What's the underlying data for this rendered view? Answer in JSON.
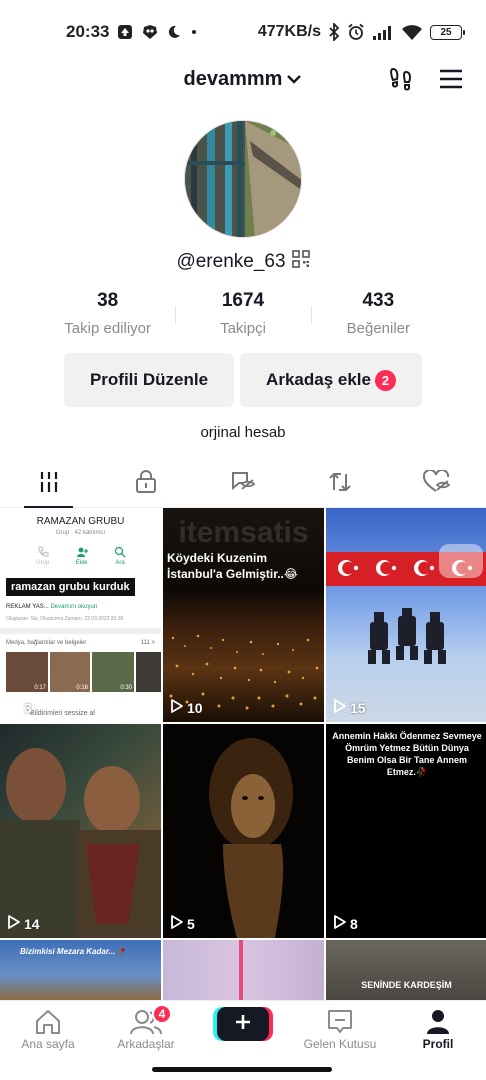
{
  "status_bar": {
    "time": "20:33",
    "net_speed": "477KB/s",
    "battery": "25"
  },
  "header": {
    "username": "devammm"
  },
  "profile": {
    "handle": "@erenke_63",
    "stats": [
      {
        "value": "38",
        "label": "Takip ediliyor"
      },
      {
        "value": "1674",
        "label": "Takipçi"
      },
      {
        "value": "433",
        "label": "Beğeniler"
      }
    ],
    "edit_button": "Profili Düzenle",
    "add_friend_button": "Arkadaş ekle",
    "add_friend_badge": "2",
    "bio": "orjinal hesab"
  },
  "videos": [
    {
      "views": "3",
      "group_title": "RAMAZAN GRUBU",
      "group_sub": "Grup · 42 katılımcı",
      "actions": [
        "Grup",
        "Ekle",
        "Ara"
      ],
      "sticker": "ramazan grubu kurduk",
      "desc": "REKLAM YAS...",
      "more": "Devamını okuyun",
      "created": "Oluşturan: Siz, Oluşturma Zamanı: 22.03.2023 20:36",
      "media_label": "Medya, bağlantılar ve belgeler",
      "media_count": "111 >",
      "thumb_times": [
        "0:17",
        "0:16",
        "0:30"
      ],
      "mute_label": "Bildirimleri sessize al"
    },
    {
      "views": "10",
      "caption": "Köydeki Kuzenim İstanbul'a Gelmiştir..😂",
      "watermark": "itemsatis"
    },
    {
      "views": "15"
    },
    {
      "views": "14"
    },
    {
      "views": "5"
    },
    {
      "views": "8",
      "caption": "Annemin Hakkı Ödenmez Sevmeye Ömrüm Yetmez Bütün Dünya Benim Olsa Bir Tane Annem Etmez.🥀"
    },
    {
      "caption": "Bizimkisi Mezara Kadar...🥀"
    },
    {},
    {
      "caption": "SENİNDE KARDEŞİM"
    }
  ],
  "bottom_nav": [
    {
      "label": "Ana sayfa"
    },
    {
      "label": "Arkadaşlar",
      "badge": "4"
    },
    {
      "label": ""
    },
    {
      "label": "Gelen Kutusu"
    },
    {
      "label": "Profil"
    }
  ],
  "colors": {
    "accent": "#fe2c55",
    "cyan": "#25f4ee",
    "text": "#161823",
    "muted": "#8a8b91"
  }
}
